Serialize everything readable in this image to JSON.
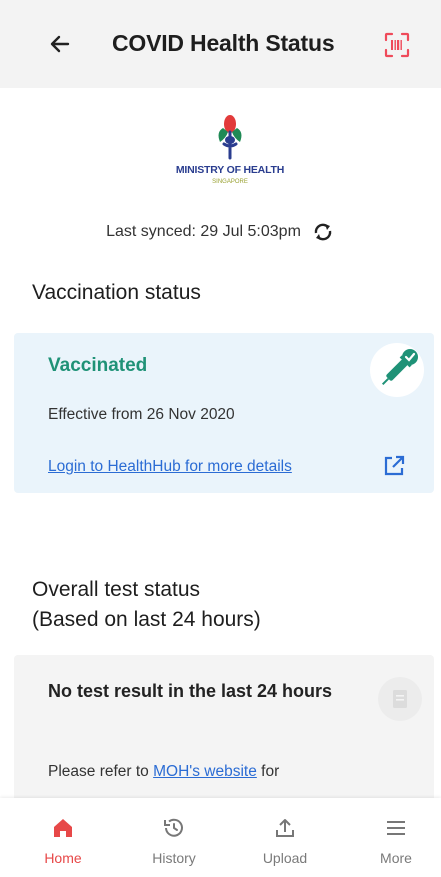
{
  "header": {
    "title": "COVID Health Status",
    "back_icon": "arrow-left-icon",
    "scan_icon": "qr-scan-icon"
  },
  "logo": {
    "text": "MINISTRY OF HEALTH",
    "sub": "SINGAPORE"
  },
  "sync": {
    "text": "Last synced: 29 Jul 5:03pm",
    "icon": "refresh-icon"
  },
  "vaccination": {
    "section_title": "Vaccination status",
    "status": "Vaccinated",
    "effective": "Effective from 26 Nov 2020",
    "link": "Login to HealthHub for more details",
    "status_color": "#1f9277"
  },
  "test": {
    "section_title_line1": "Overall test status",
    "section_title_line2": "(Based on last 24 hours)",
    "result": "No test result in the last 24 hours",
    "refer_prefix": "Please refer to ",
    "refer_link": "MOH's website",
    "refer_suffix": " for"
  },
  "nav": {
    "items": [
      {
        "label": "Home",
        "icon": "home-icon",
        "active": true
      },
      {
        "label": "History",
        "icon": "history-icon",
        "active": false
      },
      {
        "label": "Upload",
        "icon": "upload-icon",
        "active": false
      },
      {
        "label": "More",
        "icon": "menu-icon",
        "active": false
      }
    ],
    "active_color": "#e74848"
  }
}
